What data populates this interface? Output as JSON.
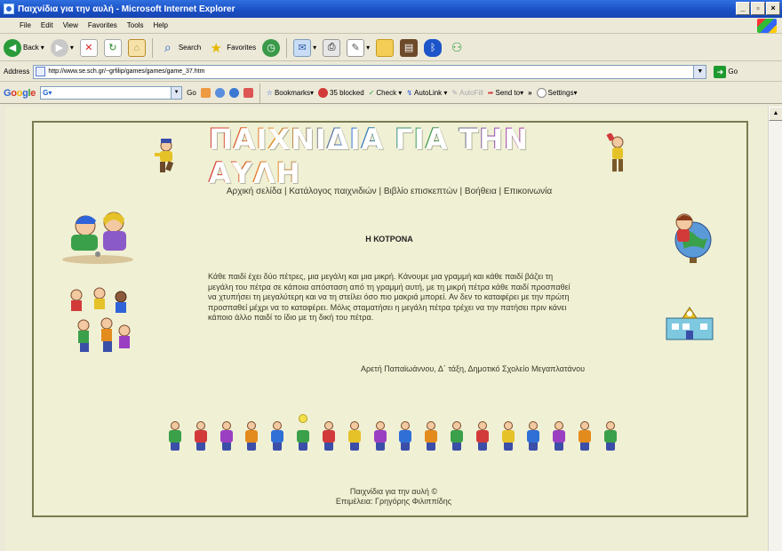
{
  "window": {
    "title": "Παιχνίδια για την αυλή - Microsoft Internet Explorer",
    "controls": [
      "_",
      "▫",
      "×"
    ]
  },
  "menu": [
    "File",
    "Edit",
    "View",
    "Favorites",
    "Tools",
    "Help"
  ],
  "toolbar": {
    "back_label": "Back",
    "search_label": "Search",
    "favorites_label": "Favorites"
  },
  "address": {
    "label": "Address",
    "url": "http://www.se.sch.gr/~grfilip/games/games/game_37.htm",
    "go_label": "Go"
  },
  "googlebar": {
    "logo": "Google",
    "input_value": "G▾",
    "go_label": "Go",
    "bookmarks_label": "Bookmarks▾",
    "blocked_label": "35 blocked",
    "check_label": "Check ▾",
    "autolink_label": "AutoLink ▾",
    "autofill_label": "AutoFill",
    "sendto_label": "Send to▾",
    "more_label": "»",
    "settings_label": "Settings▾"
  },
  "page": {
    "site_title": "ΠΑΙΧΝΙΔΙΑ ΓΙΑ ΤΗΝ ΑΥΛΗ",
    "nav_text": "Αρχική σελίδα | Κατάλογος παιχνιδιών | Βιβλίο επισκεπτών | Βοήθεια | Επικοινωνία",
    "heading": "Η ΚΟΤΡΟΝΑ",
    "paragraph": "Κάθε παιδί έχει δύο πέτρες, μια μεγάλη και μια μικρή. Κάνουμε μια γραμμή και κάθε παιδί βάζει τη μεγάλη του πέτρα σε κάποια απόσταση από τη γραμμή αυτή, με τη μικρή πέτρα κάθε παιδί προσπαθεί να χτυπήσει τη μεγαλύτερη και να τη στείλει όσο πιο μακριά μπορεί. Αν δεν το καταφέρει με την πρώτη προσπαθεί μέχρι να το καταφέρει. Μόλις σταματήσει η μεγάλη πέτρα τρέχει να την πατήσει πριν κάνει κάποιο άλλο παιδί το ίδιο με τη δική του πέτρα.",
    "author": "Αρετή Παπαϊωάννου, Δ΄ τάξη, Δημοτικό Σχολείο Μεγαπλατάνου",
    "footer_line1": "Παιχνίδια για την αυλή ©",
    "footer_line2": "Επιμέλεια: Γρηγόρης Φιλιππίδης"
  },
  "colors": {
    "page_bg": "#eeeed6",
    "content_bg": "#f0f0d4",
    "border": "#7b7b52",
    "title_colors": [
      "#d23a3a",
      "#e38b1d",
      "#2f6fd6",
      "#3aa04a",
      "#9a3fc2",
      "#d23a3a"
    ]
  }
}
